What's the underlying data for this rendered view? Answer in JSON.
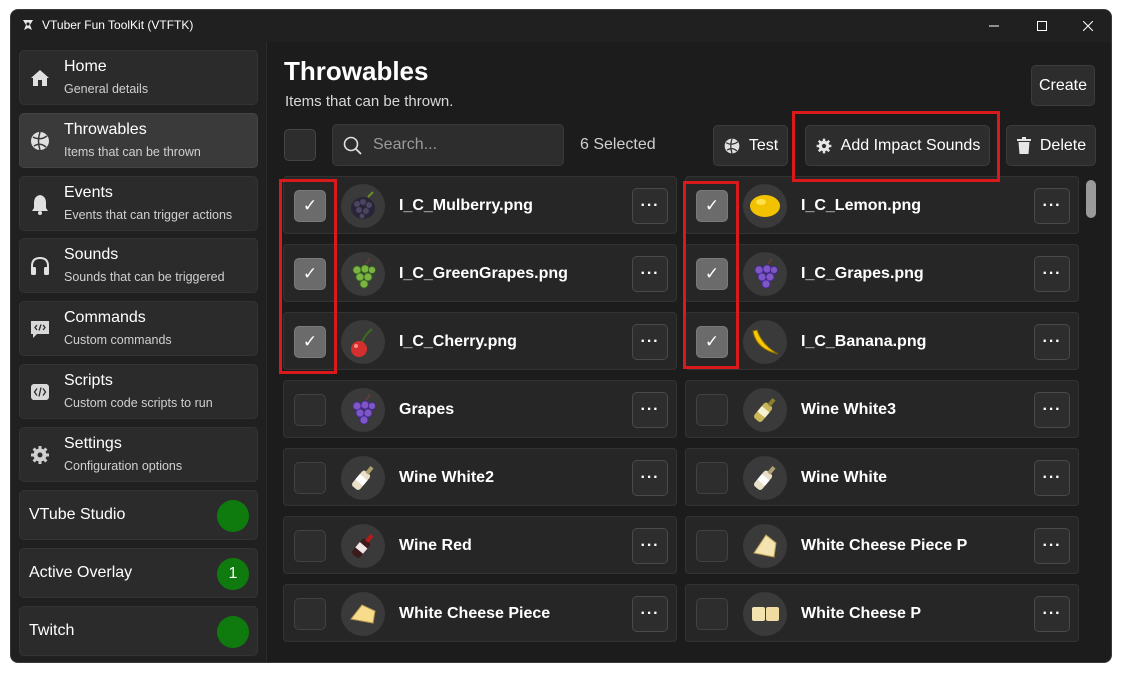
{
  "window": {
    "title": "VTuber Fun ToolKit (VTFTK)"
  },
  "sidebar": {
    "items": [
      {
        "title": "Home",
        "subtitle": "General details"
      },
      {
        "title": "Throwables",
        "subtitle": "Items that can be thrown"
      },
      {
        "title": "Events",
        "subtitle": "Events that can trigger actions"
      },
      {
        "title": "Sounds",
        "subtitle": "Sounds that can be triggered"
      },
      {
        "title": "Commands",
        "subtitle": "Custom commands"
      },
      {
        "title": "Scripts",
        "subtitle": "Custom code scripts to run"
      },
      {
        "title": "Settings",
        "subtitle": "Configuration options"
      }
    ],
    "status": [
      {
        "label": "VTube Studio",
        "value": ""
      },
      {
        "label": "Active Overlay",
        "value": "1"
      },
      {
        "label": "Twitch",
        "value": ""
      }
    ],
    "status_color": "#0f7b0f"
  },
  "main": {
    "title": "Throwables",
    "subtitle": "Items that can be thrown.",
    "create_label": "Create",
    "search_placeholder": "Search...",
    "selected_count": "6 Selected",
    "test_label": "Test",
    "add_sounds_label": "Add Impact Sounds",
    "delete_label": "Delete",
    "check_glyph": "✓",
    "more_glyph": "···",
    "items": [
      {
        "name": "I_C_Mulberry.png",
        "checked": true,
        "icon": "mulberry-icon"
      },
      {
        "name": "I_C_Lemon.png",
        "checked": true,
        "icon": "lemon-icon"
      },
      {
        "name": "I_C_GreenGrapes.png",
        "checked": true,
        "icon": "green-grapes-icon"
      },
      {
        "name": "I_C_Grapes.png",
        "checked": true,
        "icon": "grapes-icon"
      },
      {
        "name": "I_C_Cherry.png",
        "checked": true,
        "icon": "cherry-icon"
      },
      {
        "name": "I_C_Banana.png",
        "checked": true,
        "icon": "banana-icon"
      },
      {
        "name": "Grapes",
        "checked": false,
        "icon": "grapes-icon"
      },
      {
        "name": "Wine White3",
        "checked": false,
        "icon": "wine-white-bottle-icon"
      },
      {
        "name": "Wine White2",
        "checked": false,
        "icon": "wine-white-bottle-icon"
      },
      {
        "name": "Wine White",
        "checked": false,
        "icon": "wine-white-bottle-icon"
      },
      {
        "name": "Wine Red",
        "checked": false,
        "icon": "wine-red-bottle-icon"
      },
      {
        "name": "White Cheese Piece P",
        "checked": false,
        "icon": "cheese-icon"
      },
      {
        "name": "White Cheese Piece",
        "checked": false,
        "icon": "cheese-icon"
      },
      {
        "name": "White Cheese P",
        "checked": false,
        "icon": "cheese-icon"
      }
    ]
  },
  "colors": {
    "highlight": "#d9191c",
    "background": "#1c1c1c",
    "card": "#262626"
  }
}
